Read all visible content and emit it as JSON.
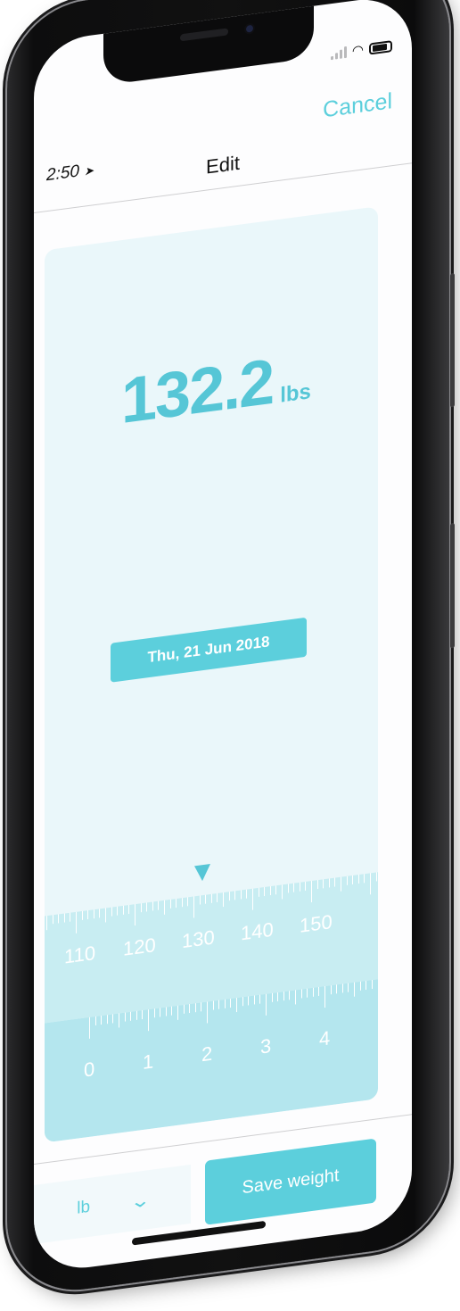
{
  "status_bar": {
    "time": "2:50"
  },
  "nav": {
    "title": "Edit",
    "cancel_label": "Cancel"
  },
  "weight": {
    "value": "132.2",
    "unit": "lbs"
  },
  "date": {
    "label": "Thu, 21 Jun 2018"
  },
  "ruler": {
    "lb_labels": [
      "110",
      "120",
      "130",
      "140",
      "150"
    ],
    "fraction_labels": [
      "0",
      "1",
      "2",
      "3",
      "4"
    ]
  },
  "bottom": {
    "unit_value": "lb",
    "save_label": "Save weight"
  },
  "colors": {
    "accent": "#5ccfdc",
    "card_bg": "#eaf7fa",
    "ruler_top": "#c8edf2",
    "ruler_bottom": "#b4e6ee"
  },
  "icons": [
    "location-arrow-icon",
    "signal-icon",
    "wifi-icon",
    "battery-icon",
    "chevron-down-icon",
    "pointer-triangle-icon"
  ]
}
